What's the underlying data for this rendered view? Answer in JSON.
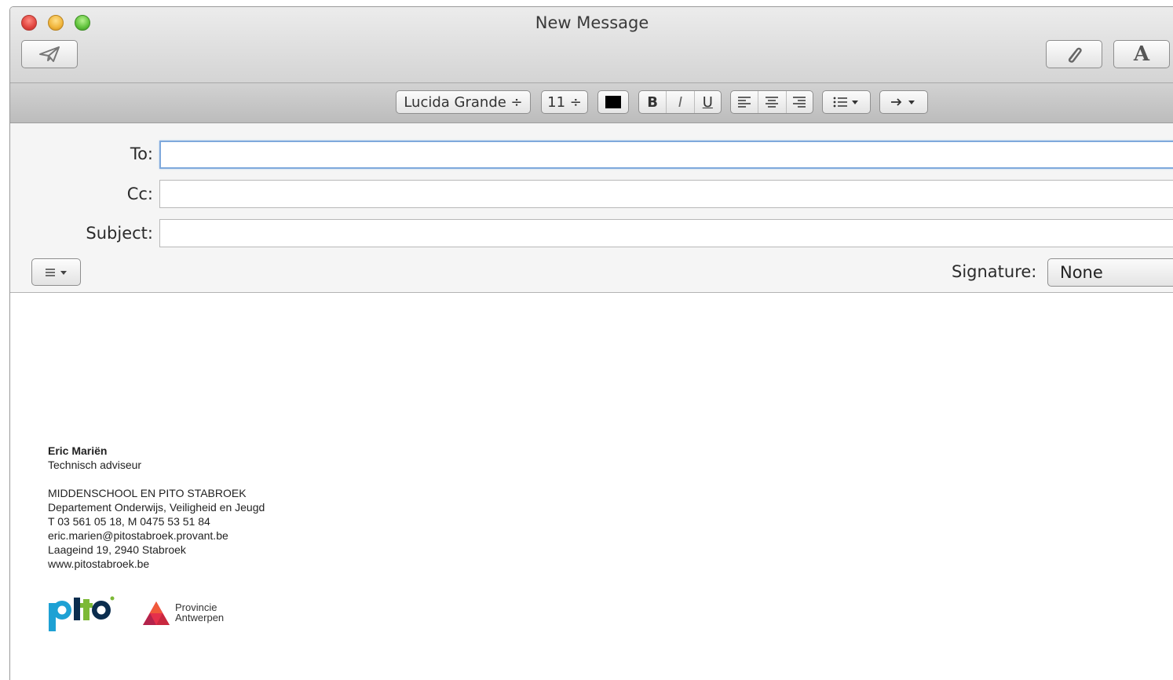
{
  "window": {
    "title": "New Message"
  },
  "toolbar": {
    "send_icon": "paper-plane-icon",
    "attach_icon": "paperclip-icon",
    "fonts_icon": "font-icon"
  },
  "format": {
    "font_family": "Lucida Grande ÷",
    "font_size": "11 ÷",
    "bold": "B",
    "italic": "I",
    "underline": "U"
  },
  "fields": {
    "to_label": "To:",
    "cc_label": "Cc:",
    "subject_label": "Subject:",
    "to_value": "",
    "cc_value": "",
    "subject_value": ""
  },
  "signature": {
    "label": "Signature:",
    "selected": "None"
  },
  "signature_block": {
    "name": "Eric Mariën",
    "role": "Technisch adviseur",
    "school": "MIDDENSCHOOL EN PITO STABROEK",
    "department": "Departement Onderwijs, Veiligheid en Jeugd",
    "phone": "T 03 561 05 18, M 0475 53 51 84",
    "email": "eric.marien@pitostabroek.provant.be",
    "address": "Laageind 19, 2940 Stabroek",
    "website": "www.pitostabroek.be",
    "logo1_text": "pito",
    "logo2_line1": "Provincie",
    "logo2_line2": "Antwerpen"
  }
}
